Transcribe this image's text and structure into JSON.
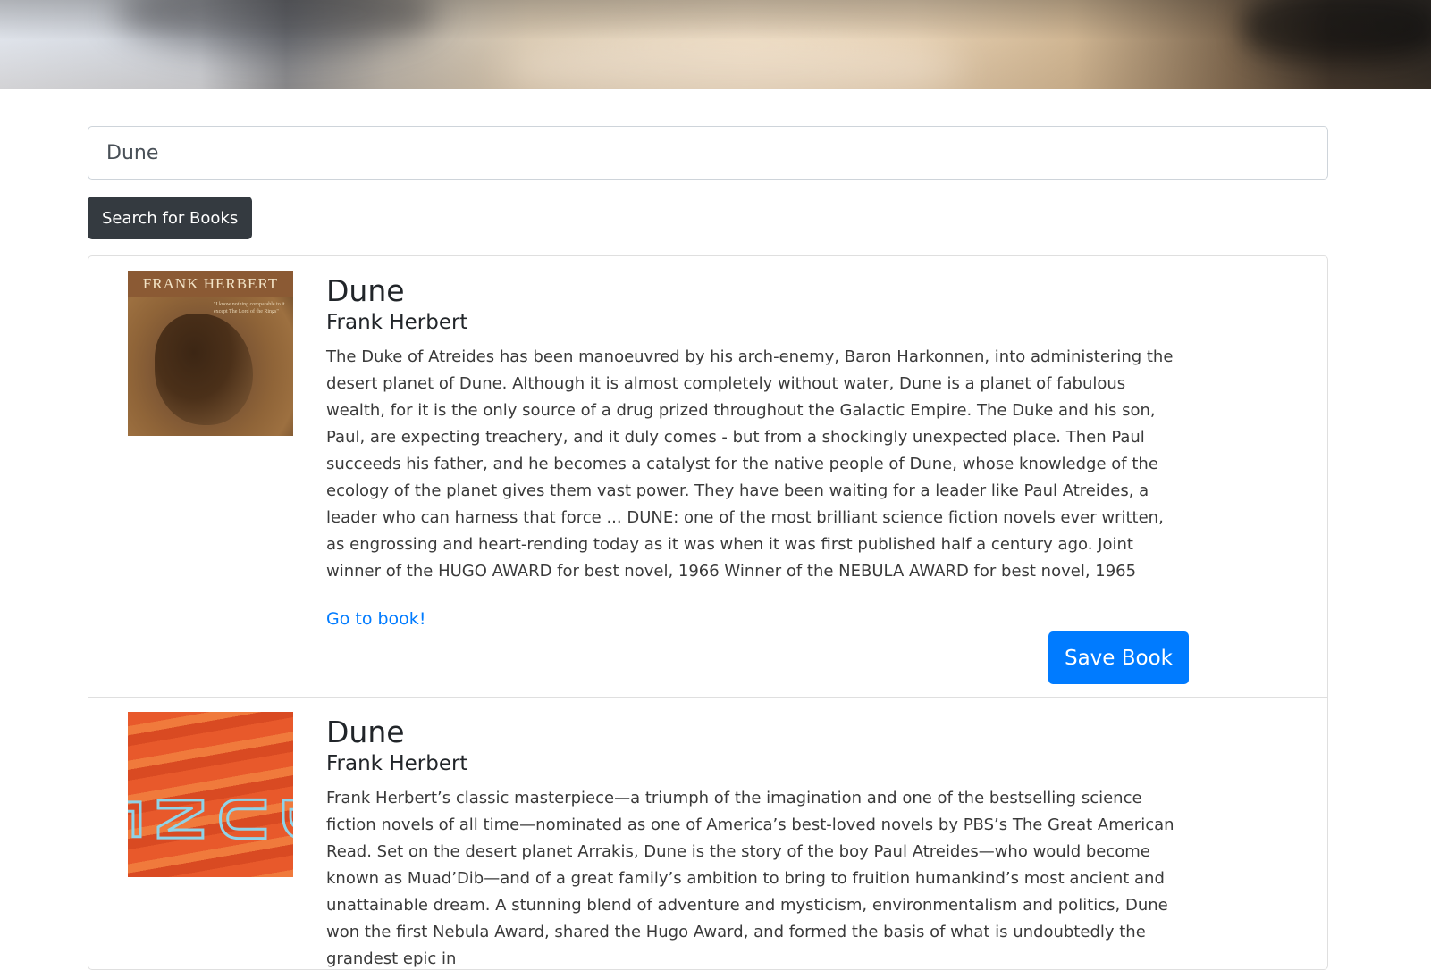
{
  "hero": {
    "background_colors": [
      "#dfe3ea",
      "#e6d3b8",
      "#2c2722"
    ]
  },
  "search": {
    "value": "Dune",
    "button_label": "Search for Books"
  },
  "books": [
    {
      "cover_text": "FRANK HERBERT",
      "cover_quote": "\"I know nothing comparable to it except The Lord of the Rings\"",
      "title": "Dune",
      "author": "Frank Herbert",
      "description": "The Duke of Atreides has been manoeuvred by his arch-enemy, Baron Harkonnen, into administering the desert planet of Dune. Although it is almost completely without water, Dune is a planet of fabulous wealth, for it is the only source of a drug prized throughout the Galactic Empire. The Duke and his son, Paul, are expecting treachery, and it duly comes - but from a shockingly unexpected place. Then Paul succeeds his father, and he becomes a catalyst for the native people of Dune, whose knowledge of the ecology of the planet gives them vast power. They have been waiting for a leader like Paul Atreides, a leader who can harness that force ... DUNE: one of the most brilliant science fiction novels ever written, as engrossing and heart-rending today as it was when it was first published half a century ago. Joint winner of the HUGO AWARD for best novel, 1966 Winner of the NEBULA AWARD for best novel, 1965",
      "link_label": "Go to book!",
      "save_label": "Save Book"
    },
    {
      "cover_letters": [
        "D",
        "U",
        "N",
        "E"
      ],
      "title": "Dune",
      "author": "Frank Herbert",
      "description": "Frank Herbert’s classic masterpiece—a triumph of the imagination and one of the bestselling science fiction novels of all time—nominated as one of America’s best-loved novels by PBS’s The Great American Read. Set on the desert planet Arrakis, Dune is the story of the boy Paul Atreides—who would become known as Muad’Dib—and of a great family’s ambition to bring to fruition humankind’s most ancient and unattainable dream. A stunning blend of adventure and mysticism, environmentalism and politics, Dune won the first Nebula Award, shared the Hugo Award, and formed the basis of what is undoubtedly the grandest epic in"
    }
  ],
  "colors": {
    "primary": "#007bff",
    "dark": "#343a40",
    "border": "#dfdfdf"
  }
}
